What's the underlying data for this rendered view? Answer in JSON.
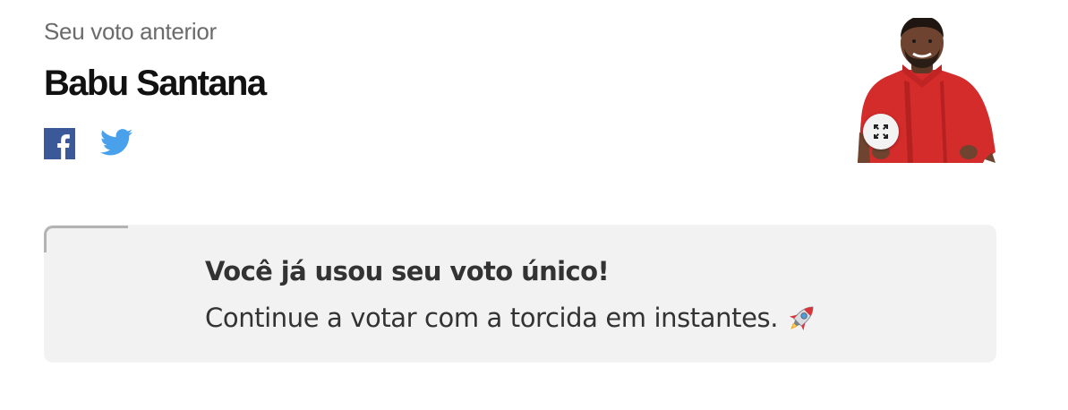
{
  "header": {
    "subtitle": "Seu voto anterior",
    "candidate_name": "Babu Santana"
  },
  "share": {
    "facebook_icon": "facebook-icon",
    "twitter_icon": "twitter-icon"
  },
  "photo": {
    "alt": "Babu Santana",
    "expand_icon": "expand-icon"
  },
  "notice": {
    "title": "Você já usou seu voto único!",
    "message": "Continue a votar com a torcida em instantes.",
    "emoji_icon": "rocket-icon"
  },
  "colors": {
    "facebook": "#3b5998",
    "twitter": "#4aa1eb",
    "notice_bg": "#f2f2f2",
    "shirt": "#d42b2b"
  }
}
